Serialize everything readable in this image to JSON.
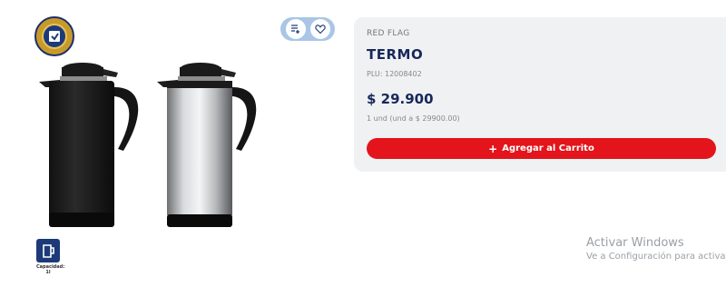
{
  "product": {
    "brand": "RED FLAG",
    "title": "TERMO",
    "plu": "PLU: 12008402",
    "price": "$ 29.900",
    "unit_price": "1 und (und a $ 29900.00)",
    "add_to_cart_label": "Agregar al Carrito"
  },
  "capacity": {
    "label_line1": "Capacidad:",
    "label_line2": "1l"
  },
  "actions": {
    "icons": [
      "add-to-list-icon",
      "heart-icon"
    ]
  },
  "watermark": {
    "line1": "Activar Windows",
    "line2": "Ve a Configuración para activar"
  },
  "colors": {
    "accent_red": "#e3141b",
    "navy": "#17285a",
    "card_bg": "#f0f1f3"
  }
}
